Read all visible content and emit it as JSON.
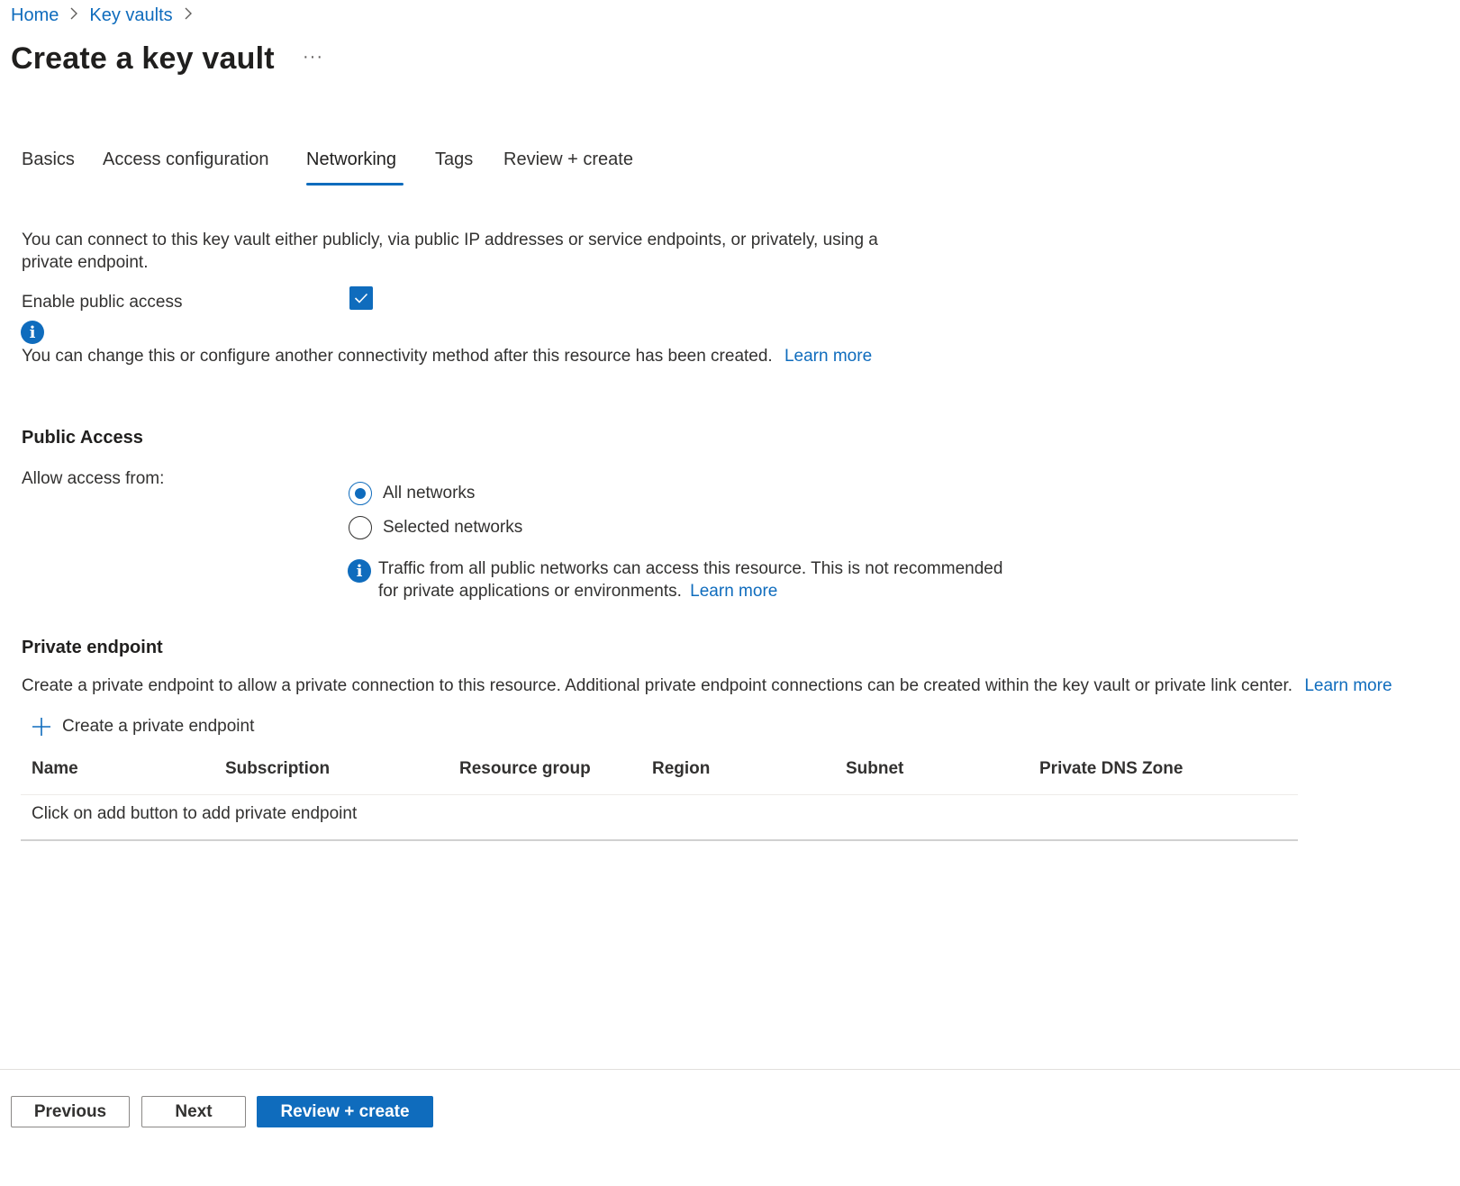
{
  "breadcrumb": {
    "items": [
      "Home",
      "Key vaults"
    ],
    "separator_icon": "chevron-right-icon"
  },
  "page": {
    "title": "Create a key vault",
    "more_label": "···"
  },
  "tabs": [
    {
      "label": "Basics",
      "active": false
    },
    {
      "label": "Access configuration",
      "active": false
    },
    {
      "label": "Networking",
      "active": true
    },
    {
      "label": "Tags",
      "active": false
    },
    {
      "label": "Review + create",
      "active": false
    }
  ],
  "networking": {
    "intro": "You can connect to this key vault either publicly, via public IP addresses or service endpoints, or privately, using a private endpoint.",
    "enable_public_access_label": "Enable public access",
    "enable_public_access_checked": true,
    "change_note": "You can change this or configure another connectivity method after this resource has been created.",
    "change_note_link": "Learn more"
  },
  "public_access": {
    "heading": "Public Access",
    "allow_label": "Allow access from:",
    "options": [
      {
        "label": "All networks",
        "selected": true
      },
      {
        "label": "Selected networks",
        "selected": false
      }
    ],
    "info_line1": "Traffic from all public networks can access this resource. This is not recommended",
    "info_line2": "for private applications or environments.",
    "info_link": "Learn more"
  },
  "private_endpoint": {
    "heading": "Private endpoint",
    "description": "Create a private endpoint to allow a private connection to this resource. Additional private endpoint connections can be created within the key vault or private link center.",
    "description_link": "Learn more",
    "create_label": "Create a private endpoint",
    "columns": [
      "Name",
      "Subscription",
      "Resource group",
      "Region",
      "Subnet",
      "Private DNS Zone"
    ],
    "empty_message": "Click on add button to add private endpoint"
  },
  "footer": {
    "previous": "Previous",
    "next": "Next",
    "review_create": "Review + create"
  },
  "colors": {
    "accent": "#0f6cbd",
    "text": "#323130"
  }
}
